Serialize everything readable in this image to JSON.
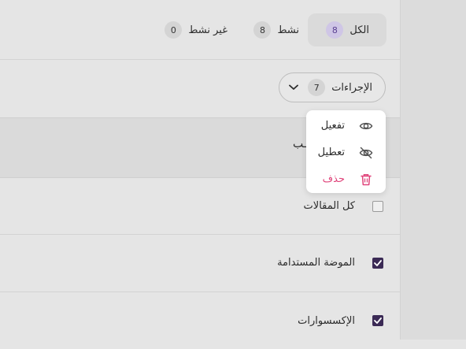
{
  "tabs": [
    {
      "label": "الكل",
      "count": "8",
      "active": true
    },
    {
      "label": "نشط",
      "count": "8",
      "active": false
    },
    {
      "label": "غير نشط",
      "count": "0",
      "active": false
    }
  ],
  "actions": {
    "label": "الإجراءات",
    "count": "7"
  },
  "menu": {
    "items": [
      {
        "label": "تفعيل",
        "icon": "eye-icon"
      },
      {
        "label": "تعطيل",
        "icon": "eye-off-icon"
      },
      {
        "label": "حذف",
        "icon": "trash-icon",
        "color": "#e0457b"
      }
    ]
  },
  "table": {
    "header_fragment": "ـب",
    "rows": [
      {
        "label": "كل المقالات",
        "checked": false
      },
      {
        "label": "الموضة المستدامة",
        "checked": true
      },
      {
        "label": "الإكسسوارات",
        "checked": true
      }
    ]
  },
  "colors": {
    "accent": "#3b2a55",
    "danger": "#e0457b",
    "badge_active": "#cfc6e6"
  }
}
